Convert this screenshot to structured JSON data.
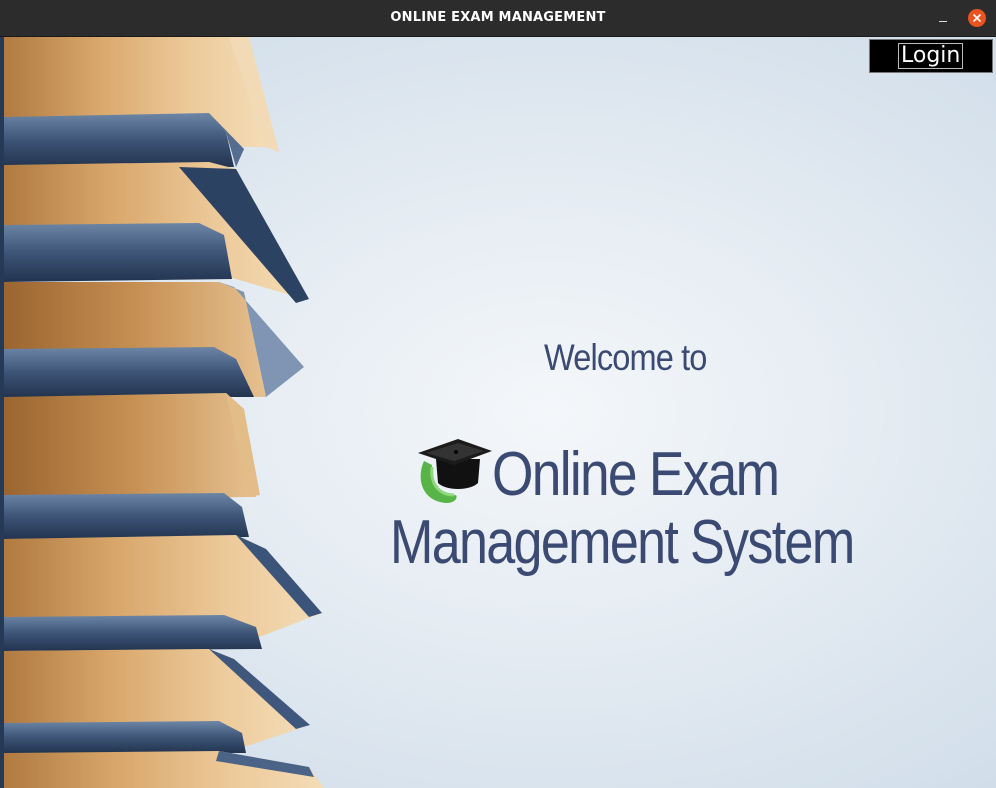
{
  "window": {
    "title": "ONLINE EXAM MANAGEMENT",
    "minimize_label": "–"
  },
  "toolbar": {
    "login_label": "Login"
  },
  "hero": {
    "welcome": "Welcome to",
    "app_name_line1": "Online Exam",
    "app_name_line2": "Management System"
  },
  "icons": {
    "logo": "graduation-cap-icon",
    "close": "close-icon",
    "minimize": "minimize-icon"
  },
  "colors": {
    "titlebar": "#2c2c2c",
    "close_button": "#e95420",
    "heading_text": "#3a4a72",
    "login_background": "#000000",
    "login_text": "#ffffff"
  }
}
